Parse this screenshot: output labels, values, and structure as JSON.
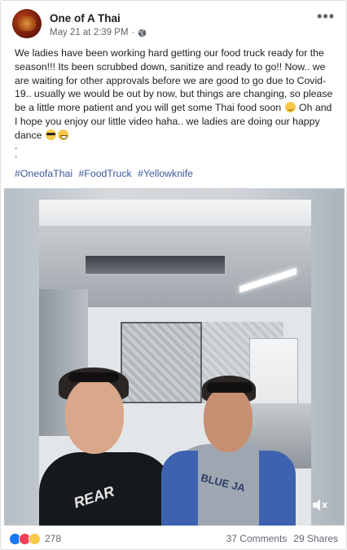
{
  "post": {
    "page_name": "One of A Thai",
    "timestamp": "May 21 at 2:39 PM",
    "meta_separator": "·",
    "privacy_icon": "globe-icon",
    "more_icon": "more-horizontal-icon",
    "text": {
      "line_a": "We ladies have been working hard getting our food truck ready for the season!!! Its been scrubbed down, sanitize and ready to go!! Now.. we are waiting for other approvals before we are good to go due to Covid-19.. usually we would be out by now, but things are changing, so please be a little more patient and you will get some Thai food soon",
      "line_b": "Oh and I hope you enjoy our little video haha.. we ladies are doing our happy dance",
      "emoji_1": "smiling-face-icon",
      "emoji_2": "sunglasses-face-icon",
      "emoji_3": "grinning-face-icon",
      "dot_1": ".",
      "dot_2": "."
    },
    "hashtags": [
      "#OneofaThai",
      "#FoodTruck",
      "#Yellowknife"
    ]
  },
  "video": {
    "shirt_text_left": "REAR",
    "shirt_text_right": "BLUE JA",
    "mute_icon": "speaker-muted-icon"
  },
  "footer": {
    "reactions": [
      "like-icon",
      "love-icon",
      "haha-icon"
    ],
    "reaction_count": "278",
    "comments": "37 Comments",
    "shares": "29 Shares"
  }
}
